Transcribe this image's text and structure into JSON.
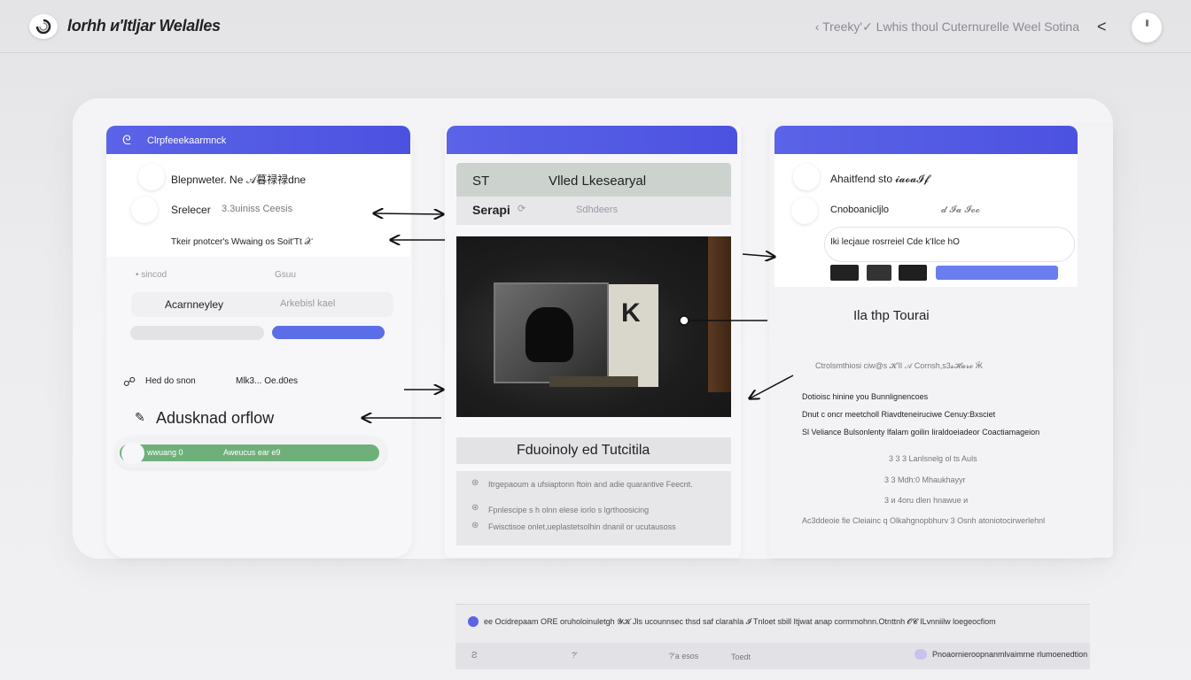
{
  "header": {
    "app_title": "lorhh ᴎ'Itljar Welalles",
    "breadcrumb": "‹ Treeky'✓ Lwhis thoul Cuternurelle  Weel Sotina",
    "back_label": "<"
  },
  "left_panel": {
    "header_label": "Clrpfeeekaarmnck",
    "rows": [
      "Blepnweter. Ne 𝒜暮禄禄dne",
      "Srelecer",
      "3.3uiniss  Ceesis",
      "Tkeir pnotcer's Wwaing os Soit'Tt 𝒳",
      "• sincod",
      "Gsuu",
      "Acarnneyley",
      "Arkebisl kael",
      "Hed do snon",
      "Mlk3... Oe.d0es",
      "Adusknad orflow",
      "wwuang 0",
      "Aweucus ear  e9"
    ]
  },
  "center_panel": {
    "form_label_1": "ST",
    "form_value_1": "Vlled Lkesearyal",
    "form_label_2": "Serapi",
    "form_placeholder_2": "Sdhdeers",
    "section_title": "Fduoinoly ed Tutcitila",
    "items": [
      "Itrgepaoum a ufsiaptonn ftoin and adie quarantive Feecnt.",
      "Fpnlescipe s h olnn elese iorlo s lgrthoosicing",
      "Fwisctisoe onlet,ueplastetsolhin dnanil or ucutausoss"
    ]
  },
  "right_panel": {
    "rows": [
      "Ahaitfend sto 𝓲𝓪𝓸𝓪𝓘𝓯",
      "Cnoboanicljlo",
      "𝓭 𝓘𝓪 𝓘𝓸𝓸",
      "Iki lecjaue  rosrreiel Cde k'Ilce hO"
    ],
    "tip_title": "Ila thp Tourai",
    "subtitle": "Ctrolsmthiosi ciw@s 𝓚'lI 𝒜 Cornsh,s3𝓼𝓗𝓪𝓻𝓸 Ӝ",
    "notes": [
      "Dotioisc hinine you Bunnlignencoes",
      "Dnut c oncr meetcholl  Riavdteneiruciwe Cenuy:Bxsciet",
      "Sl Veliance Bulsonlenty lfalam goilin Iiraldoeiadeor Coactiamageion",
      "3 3 3 Lanlsnelg ol  ts Auls",
      "3 3 Mdh:0 Mhaukhayyr",
      "3 ᴎ 4oru dlen hnawue ᴎ",
      "Ac3ddeoie fie Cleiainc q Olkahgnopbhurv 3 Osnh  atoniotocirwerlehnl"
    ]
  },
  "footer": {
    "text": "ee Ocidrepaam  ORE oruholoinuletgh 𝓨𝓚 Jls ucounnsec thsd saf clarahla 𝓘 Tnloet sbill  Itjwat anap cormmohnn.Otnttnh 𝓞𝓒 ILvnniilw loegeocfiom",
    "strip_1": "Ƨ",
    "strip_2": "?'",
    "strip_3": "?'a esos",
    "strip_4": "Toedt",
    "strip_5": "Pnoaornieroopnanmlvaimrne rlumoenedtion"
  },
  "colors": {
    "accent": "#5b63e8",
    "green": "#6fb07a",
    "blue_bar": "#6a7ef0"
  }
}
